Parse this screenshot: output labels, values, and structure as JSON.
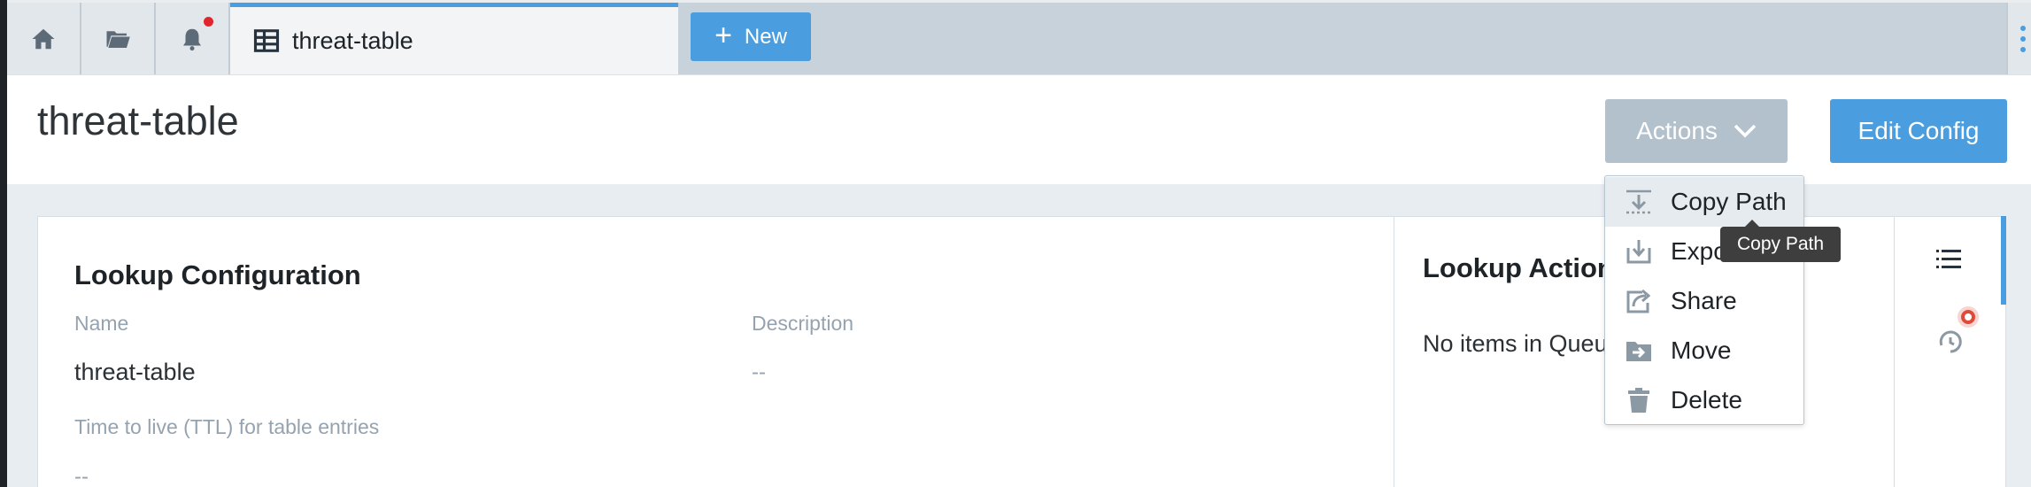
{
  "tabs": {
    "home_icon": "home-icon",
    "folder_icon": "folder-icon",
    "bell_icon": "bell-icon",
    "active_tab": {
      "icon": "table-icon",
      "label": "threat-table"
    },
    "new_button": "New"
  },
  "header": {
    "title": "threat-table",
    "actions_label": "Actions",
    "edit_config_label": "Edit Config"
  },
  "lookup_config": {
    "title": "Lookup Configuration",
    "name_label": "Name",
    "name_value": "threat-table",
    "description_label": "Description",
    "description_value": "--",
    "ttl_label": "Time to live (TTL) for table entries",
    "ttl_value": "--"
  },
  "lookup_actions": {
    "title": "Lookup Action",
    "empty_text": "No items in Queu"
  },
  "actions_menu": {
    "items": [
      {
        "label": "Copy Path",
        "icon": "download-icon"
      },
      {
        "label": "Expo",
        "icon": "export-icon"
      },
      {
        "label": "Share",
        "icon": "share-icon"
      },
      {
        "label": "Move",
        "icon": "move-folder-icon"
      },
      {
        "label": "Delete",
        "icon": "trash-icon"
      }
    ],
    "tooltip": "Copy Path"
  },
  "colors": {
    "accent": "#4a9ee0",
    "actions_button": "#b3c1cc",
    "notification": "#e0262c"
  }
}
